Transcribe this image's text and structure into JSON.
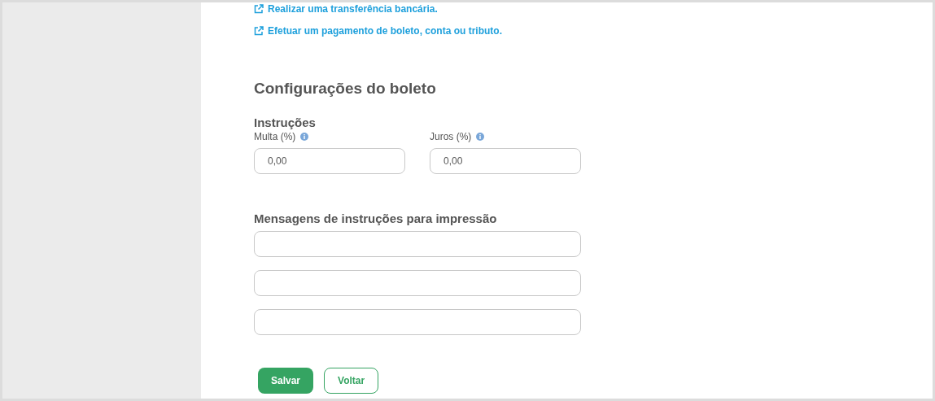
{
  "links": [
    "Realizar uma transferência bancária.",
    "Efetuar um pagamento de boleto, conta ou tributo."
  ],
  "section_title": "Configurações do boleto",
  "instructions": {
    "title": "Instruções",
    "fields": [
      {
        "label": "Multa (%)",
        "value": "0,00"
      },
      {
        "label": "Juros (%)",
        "value": "0,00"
      }
    ]
  },
  "messages": {
    "title": "Mensagens de instruções para impressão",
    "fields": [
      {
        "kind": "text"
      },
      {
        "kind": "text"
      },
      {
        "kind": "text"
      }
    ]
  },
  "buttons": [
    {
      "label": "Salvar",
      "kind": "primary"
    },
    {
      "label": "Voltar",
      "kind": "secondary"
    }
  ]
}
